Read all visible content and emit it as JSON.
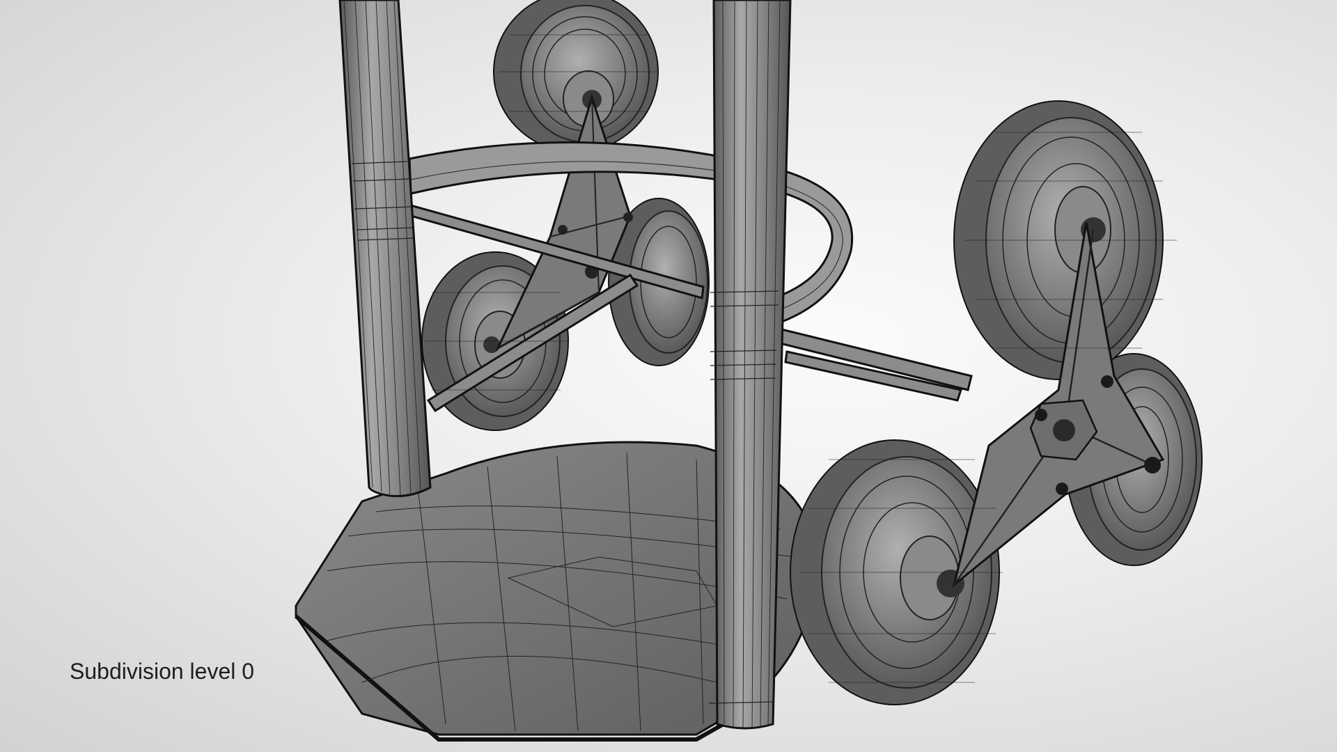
{
  "viewport": {
    "caption": "Subdivision level 0",
    "background_center": "#fbfbfb",
    "background_edge": "#d2d2d2",
    "surface_color": "#7a7a7a",
    "wire_color": "#1a1a1a"
  },
  "model": {
    "subject": "stair-climbing hand truck wireframe mesh"
  }
}
